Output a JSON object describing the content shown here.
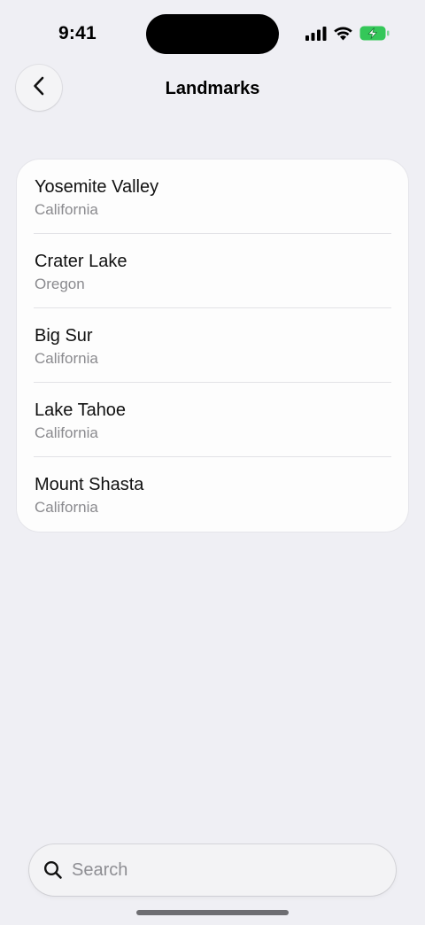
{
  "status_bar": {
    "time": "9:41",
    "icons": [
      "cellular-signal-icon",
      "wifi-icon",
      "battery-charging-icon"
    ],
    "battery_color": "#34c759"
  },
  "nav": {
    "back_icon": "chevron-left-icon",
    "title": "Landmarks"
  },
  "landmarks": [
    {
      "name": "Yosemite Valley",
      "state": "California"
    },
    {
      "name": "Crater Lake",
      "state": "Oregon"
    },
    {
      "name": "Big Sur",
      "state": "California"
    },
    {
      "name": "Lake Tahoe",
      "state": "California"
    },
    {
      "name": "Mount Shasta",
      "state": "California"
    }
  ],
  "search": {
    "icon": "magnifying-glass-icon",
    "placeholder": "Search",
    "value": ""
  }
}
